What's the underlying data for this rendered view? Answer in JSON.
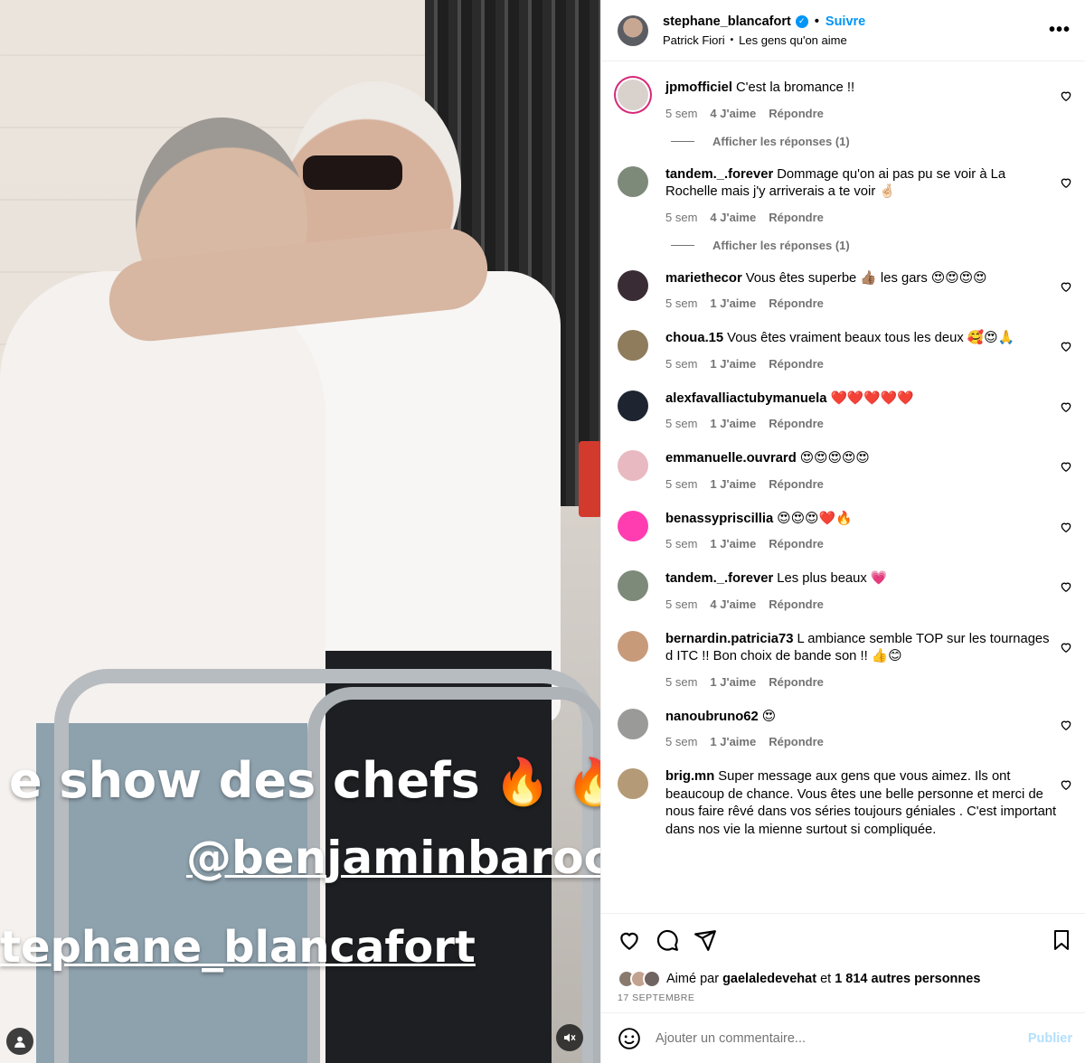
{
  "colors": {
    "accent": "#0095f6",
    "muted": "#737373",
    "publish_disabled": "#b2dffc"
  },
  "media": {
    "overlay_line1": "e show des chefs",
    "overlay_line1_emoji": "🔥 🔥 🔥",
    "overlay_line2": "@benjaminbaroc",
    "overlay_line3": "tephane_blancafort",
    "icons": [
      "user-icon",
      "mute-icon"
    ]
  },
  "header": {
    "username": "stephane_blancafort",
    "dot": "•",
    "follow_label": "Suivre",
    "music_artist": "Patrick Fiori",
    "music_dot": "•",
    "music_title": "Les gens qu'on aime",
    "more_label": "•••"
  },
  "comments": [
    {
      "user": "jpmofficiel",
      "text": "C'est la bromance !!",
      "age": "5 sem",
      "likes": "4 J'aime",
      "reply": "Répondre",
      "replies": "Afficher les réponses (1)",
      "avatar": "#d9d2cc"
    },
    {
      "user": "tandem._.forever",
      "text": "Dommage qu'on ai pas pu se voir à La Rochelle mais j'y arriverais a te voir 🤞🏻",
      "age": "5 sem",
      "likes": "4 J'aime",
      "reply": "Répondre",
      "replies": "Afficher les réponses (1)",
      "avatar": "#7d8a7a"
    },
    {
      "user": "mariethecor",
      "text": "Vous êtes superbe 👍🏽 les gars 😍😍😍😍",
      "age": "5 sem",
      "likes": "1 J'aime",
      "reply": "Répondre",
      "avatar": "#3a2c35"
    },
    {
      "user": "choua.15",
      "text": "Vous êtes vraiment beaux tous les deux 🥰😍🙏",
      "age": "5 sem",
      "likes": "1 J'aime",
      "reply": "Répondre",
      "avatar": "#8e7c5c"
    },
    {
      "user": "alexfavalliactubymanuela",
      "text": "❤️❤️❤️❤️❤️",
      "age": "5 sem",
      "likes": "1 J'aime",
      "reply": "Répondre",
      "avatar": "#1e2430"
    },
    {
      "user": "emmanuelle.ouvrard",
      "text": "😍😍😍😍😍",
      "age": "5 sem",
      "likes": "1 J'aime",
      "reply": "Répondre",
      "avatar": "#e8b9c0"
    },
    {
      "user": "benassypriscillia",
      "text": "😍😍😍❤️🔥",
      "age": "5 sem",
      "likes": "1 J'aime",
      "reply": "Répondre",
      "avatar": "#ff3db1"
    },
    {
      "user": "tandem._.forever",
      "text": "Les plus beaux 💗",
      "age": "5 sem",
      "likes": "4 J'aime",
      "reply": "Répondre",
      "avatar": "#7d8a7a"
    },
    {
      "user": "bernardin.patricia73",
      "text": "L ambiance semble TOP sur les tournages d ITC !! Bon choix de bande son !! 👍😊",
      "age": "5 sem",
      "likes": "1 J'aime",
      "reply": "Répondre",
      "avatar": "#c79a7a"
    },
    {
      "user": "nanoubruno62",
      "text": "😍",
      "age": "5 sem",
      "likes": "1 J'aime",
      "reply": "Répondre",
      "avatar": "#9a9a98"
    },
    {
      "user": "brig.mn",
      "text": "Super message aux gens que vous aimez. Ils ont beaucoup de chance. Vous êtes une belle personne et merci de nous faire rêvé dans vos séries toujours géniales . C'est important dans nos vie la mienne surtout si compliquée.",
      "age": "",
      "likes": "",
      "reply": "",
      "avatar": "#b49a76"
    }
  ],
  "likes": {
    "prefix": "Aimé par",
    "user": "gaelaledevehat",
    "middle": "et",
    "others": "1 814 autres personnes"
  },
  "date": "17 SEPTEMBRE",
  "add_comment": {
    "placeholder": "Ajouter un commentaire...",
    "publish": "Publier"
  }
}
